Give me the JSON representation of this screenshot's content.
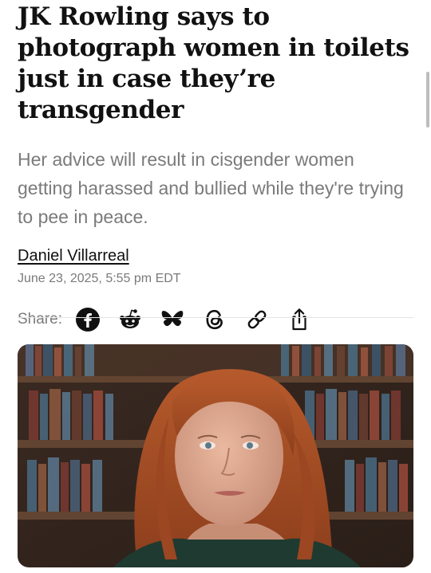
{
  "article": {
    "headline": "JK Rowling says to photograph women in toilets just in case they’re transgender",
    "subheadline": "Her advice will result in cisgender women getting harassed and bullied while they're trying to pee in peace.",
    "author": "Daniel Villarreal",
    "date": "June 23, 2025, 5:55 pm EDT"
  },
  "share": {
    "label": "Share:",
    "icons": [
      "facebook-icon",
      "reddit-icon",
      "bluesky-icon",
      "threads-icon",
      "link-icon",
      "share-upload-icon"
    ]
  },
  "colors": {
    "text": "#111111",
    "muted": "#7a7a7a",
    "divider": "#e4e4e4"
  }
}
